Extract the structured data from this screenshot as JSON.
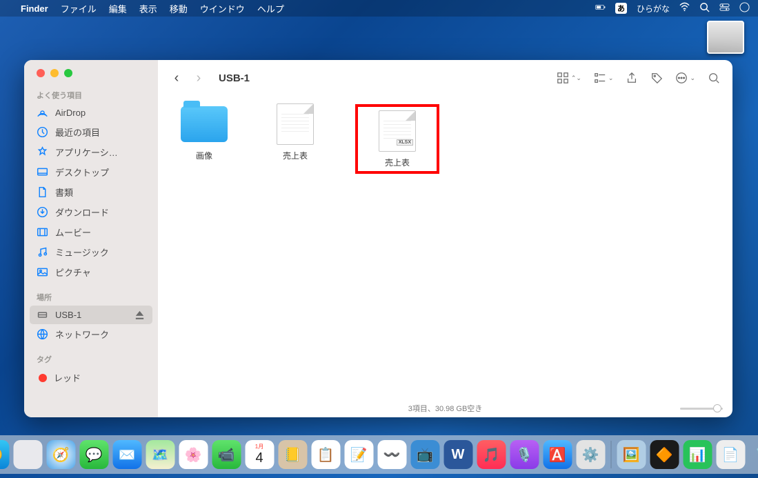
{
  "menubar": {
    "app": "Finder",
    "items": [
      "ファイル",
      "編集",
      "表示",
      "移動",
      "ウインドウ",
      "ヘルプ"
    ],
    "ime_badge": "あ",
    "ime_label": "ひらがな"
  },
  "finder": {
    "title": "USB-1",
    "sidebar": {
      "favorites_label": "よく使う項目",
      "items": [
        {
          "icon": "airdrop",
          "label": "AirDrop"
        },
        {
          "icon": "clock",
          "label": "最近の項目"
        },
        {
          "icon": "apps",
          "label": "アプリケーシ…"
        },
        {
          "icon": "desktop",
          "label": "デスクトップ"
        },
        {
          "icon": "doc",
          "label": "書類"
        },
        {
          "icon": "download",
          "label": "ダウンロード"
        },
        {
          "icon": "movie",
          "label": "ムービー"
        },
        {
          "icon": "music",
          "label": "ミュージック"
        },
        {
          "icon": "picture",
          "label": "ピクチャ"
        }
      ],
      "locations_label": "場所",
      "locations": [
        {
          "icon": "drive",
          "label": "USB-1",
          "selected": true,
          "ejectable": true
        },
        {
          "icon": "network",
          "label": "ネットワーク"
        }
      ],
      "tags_label": "タグ",
      "tags": [
        {
          "color": "#ff3b30",
          "label": "レッド"
        }
      ]
    },
    "files": [
      {
        "type": "folder",
        "name": "画像"
      },
      {
        "type": "document",
        "name": "売上表",
        "badge": ""
      },
      {
        "type": "document",
        "name": "売上表",
        "badge": "XLSX",
        "highlighted": true
      }
    ],
    "status": "3項目、30.98 GB空き"
  },
  "dock": {
    "apps": [
      "finder",
      "launchpad",
      "safari",
      "messages",
      "mail",
      "maps",
      "photos",
      "facetime",
      "calendar",
      "contacts",
      "reminders",
      "notes",
      "freeform",
      "tv",
      "music",
      "word",
      "itunes",
      "podcasts",
      "appstore",
      "settings"
    ],
    "calendar_month": "1月",
    "calendar_day": "4",
    "pinned": [
      "preview",
      "shortcuts",
      "numbers",
      "pages",
      "trash"
    ]
  }
}
